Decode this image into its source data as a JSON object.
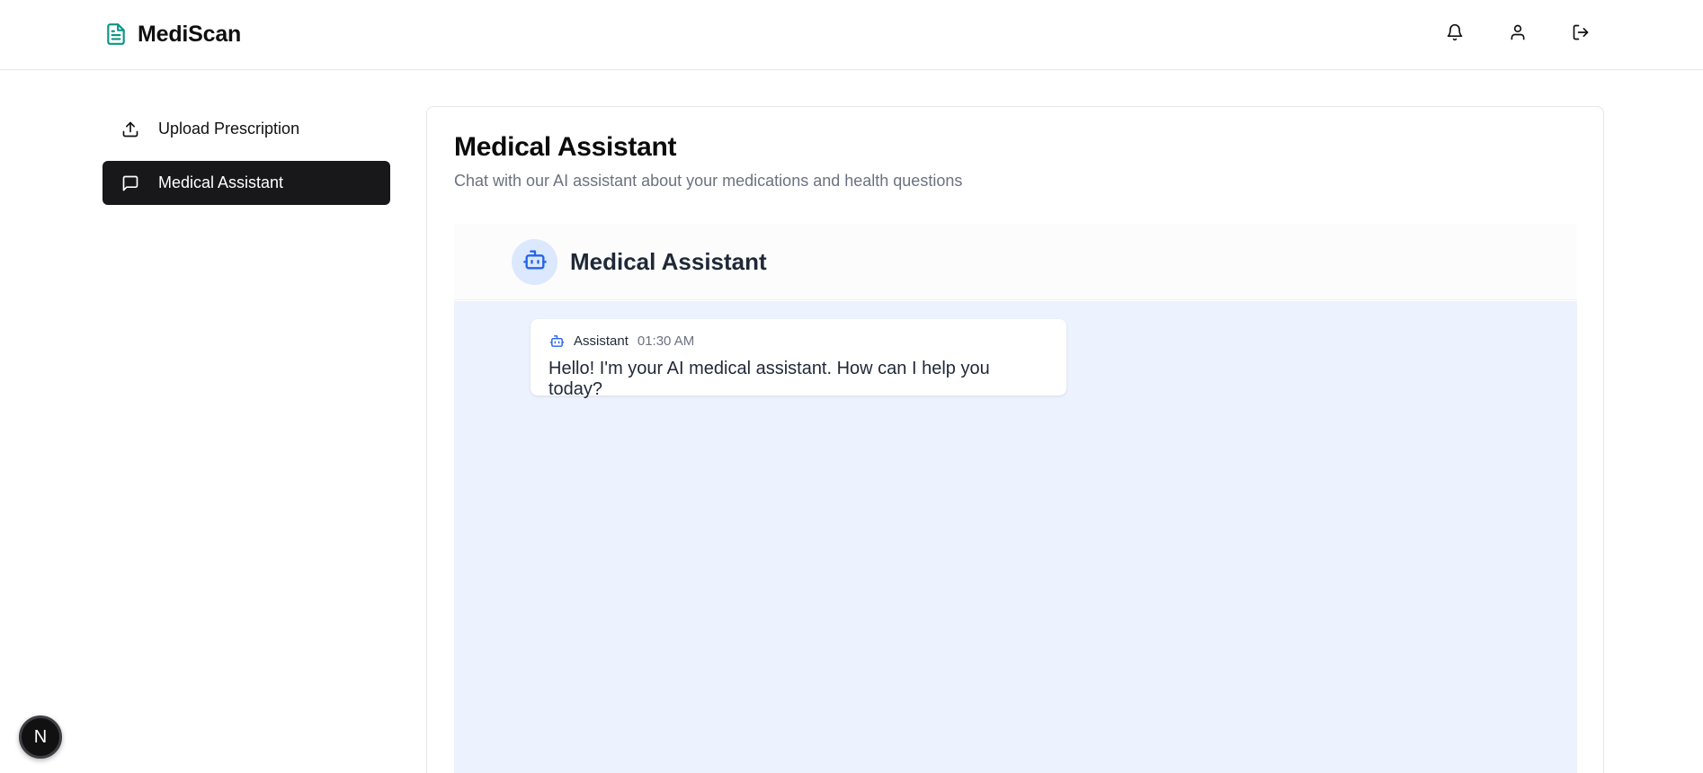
{
  "app": {
    "name": "MediScan",
    "logo_icon": "file-text-icon",
    "accent_color": "#0d9488"
  },
  "header": {
    "actions": [
      {
        "name": "notifications",
        "icon": "bell-icon"
      },
      {
        "name": "profile",
        "icon": "user-icon"
      },
      {
        "name": "logout",
        "icon": "logout-icon"
      }
    ]
  },
  "sidebar": {
    "items": [
      {
        "label": "Upload Prescription",
        "icon": "upload-icon",
        "active": false
      },
      {
        "label": "Medical Assistant",
        "icon": "message-square-icon",
        "active": true
      }
    ]
  },
  "main": {
    "title": "Medical Assistant",
    "subtitle": "Chat with our AI assistant about your medications and health questions",
    "chat": {
      "title": "Medical Assistant",
      "avatar_icon": "bot-icon",
      "messages": [
        {
          "sender": "Assistant",
          "time": "01:30 AM",
          "text": "Hello! I'm your AI medical assistant. How can I help you today?",
          "icon": "bot-icon"
        }
      ]
    }
  },
  "dev_badge": {
    "label": "N"
  }
}
